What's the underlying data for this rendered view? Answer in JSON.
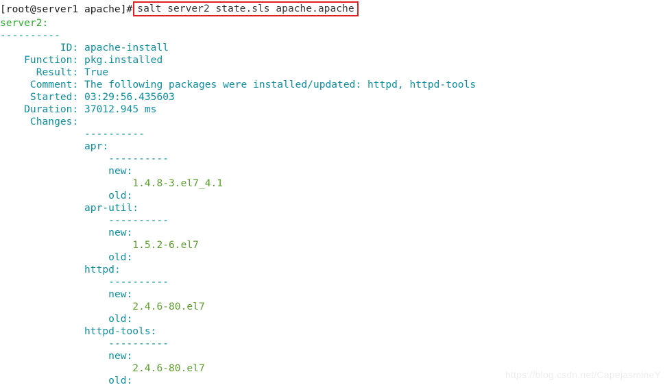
{
  "terminal": {
    "background_color": "#ffffff",
    "prompt": "[root@server1 apache]#",
    "command": "salt server2 state.sls apache.apache",
    "command_box_color": "#e02020",
    "colors": {
      "teal": "#0d8f9e",
      "green": "#2eae2e",
      "olive": "#5d9e2e",
      "separator_green": "#15a08a",
      "command_text": "#3a3a3a",
      "prompt_text": "#1a1a1a"
    },
    "minion_header": "server2:",
    "top_separator": "----------",
    "state_block": {
      "labels": {
        "id": "          ID:",
        "function": "    Function:",
        "result": "      Result:",
        "comment": "     Comment:",
        "started": "     Started:",
        "duration": "    Duration:",
        "changes": "     Changes:"
      },
      "values": {
        "id": "apache-install",
        "function": "pkg.installed",
        "result": "True",
        "comment": "The following packages were installed/updated: httpd, httpd-tools",
        "started": "03:29:56.435603",
        "duration": "37012.945 ms"
      }
    },
    "changes_separator": "----------",
    "packages": [
      {
        "name": "apr:",
        "separator": "----------",
        "new_label": "new:",
        "new_value": "1.4.8-3.el7_4.1",
        "old_label": "old:",
        "old_value": ""
      },
      {
        "name": "apr-util:",
        "separator": "----------",
        "new_label": "new:",
        "new_value": "1.5.2-6.el7",
        "old_label": "old:",
        "old_value": ""
      },
      {
        "name": "httpd:",
        "separator": "----------",
        "new_label": "new:",
        "new_value": "2.4.6-80.el7",
        "old_label": "old:",
        "old_value": ""
      },
      {
        "name": "httpd-tools:",
        "separator": "----------",
        "new_label": "new:",
        "new_value": "2.4.6-80.el7",
        "old_label": "old:",
        "old_value": ""
      }
    ],
    "watermark": "https://blog.csdn.net/CapejasmineY"
  }
}
